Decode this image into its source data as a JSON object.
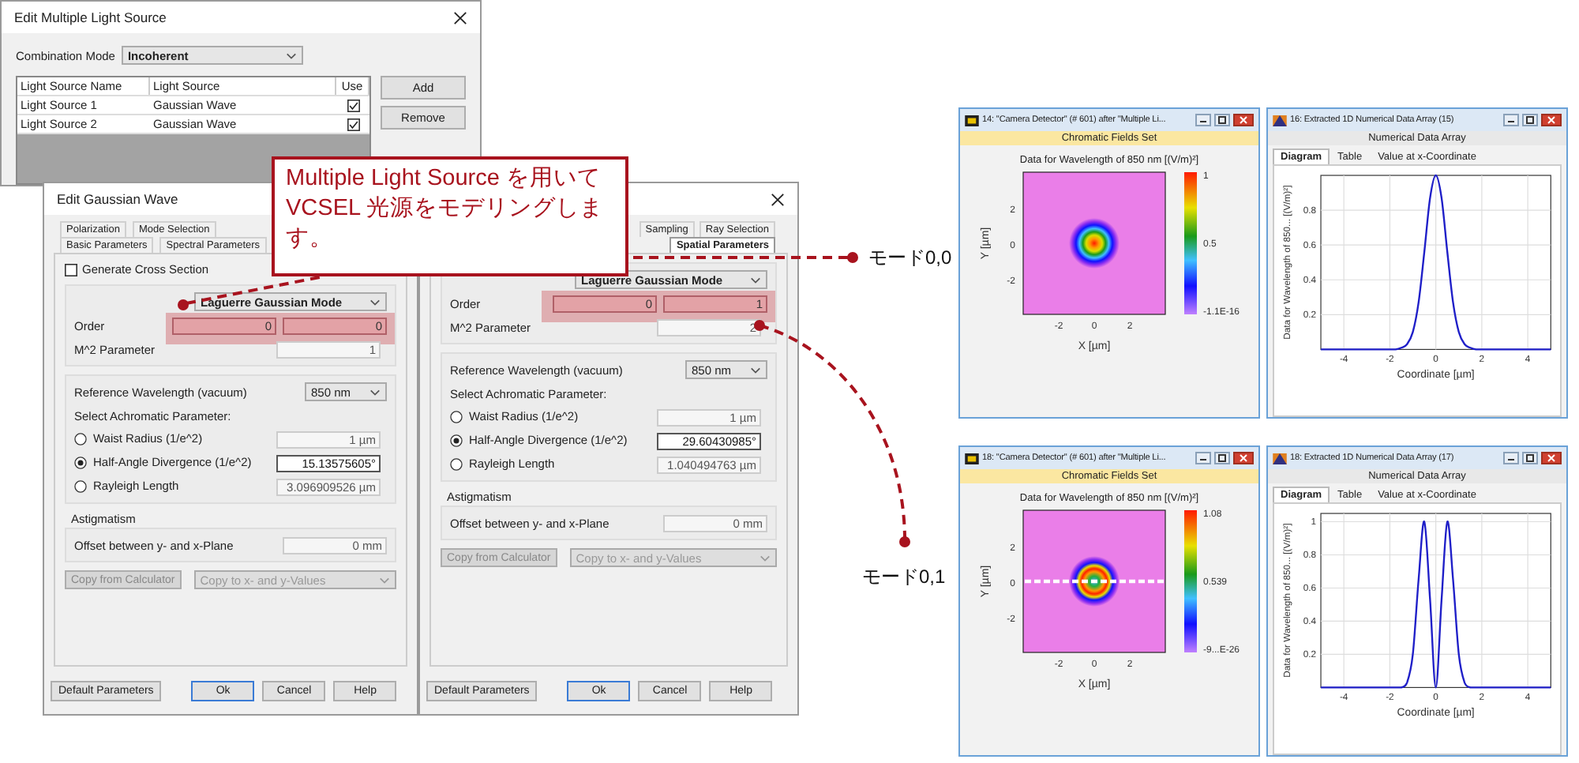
{
  "source_dialog": {
    "title": "Edit Multiple Light Source",
    "combination_label": "Combination Mode",
    "combination_value": "Incoherent",
    "columns": [
      "Light Source Name",
      "Light Source",
      "Use"
    ],
    "rows": [
      {
        "name": "Light Source 1",
        "source": "Gaussian Wave",
        "use": true
      },
      {
        "name": "Light Source 2",
        "source": "Gaussian Wave",
        "use": true
      }
    ],
    "buttons": [
      "Add",
      "Remove"
    ]
  },
  "gaussian_dialogs": [
    {
      "title": "Edit Gaussian Wave",
      "tab_rows": [
        [
          {
            "label": "Polarization",
            "selected": false
          },
          {
            "label": "Mode Selection",
            "selected": false
          }
        ],
        [
          {
            "label": "Basic Parameters",
            "selected": false
          },
          {
            "label": "Spectral Parameters",
            "selected": false
          }
        ]
      ],
      "cross_section": {
        "label": "Generate Cross Section",
        "checked": false
      },
      "mode": "Laguerre Gaussian Mode",
      "order_label": "Order",
      "order": [
        "0",
        "0"
      ],
      "m2_label": "M^2 Parameter",
      "m2": "1",
      "wavelength_label": "Reference Wavelength (vacuum)",
      "wavelength": "850 nm",
      "achromatic_label": "Select Achromatic Parameter:",
      "params": [
        {
          "label": "Waist Radius (1/e^2)",
          "value": "1 µm",
          "selected": false
        },
        {
          "label": "Half-Angle Divergence (1/e^2)",
          "value": "15.13575605°",
          "selected": true
        },
        {
          "label": "Rayleigh Length",
          "value": "3.096909526 µm",
          "selected": false
        }
      ],
      "astigmatism_label": "Astigmatism",
      "offset_label": "Offset between y- and x-Plane",
      "offset": "0 mm",
      "copy_button": "Copy from Calculator",
      "copy_select": "Copy to x- and y-Values",
      "buttons": [
        "Default Parameters",
        "Ok",
        "Cancel",
        "Help"
      ]
    },
    {
      "tab_rows": [
        [
          {
            "label": "Sampling",
            "selected": false
          },
          {
            "label": "Ray Selection",
            "selected": false
          }
        ],
        [
          {
            "label": "Spatial Parameters",
            "selected": true
          }
        ]
      ],
      "mode": "Laguerre Gaussian Mode",
      "order_label": "Order",
      "order": [
        "0",
        "1"
      ],
      "m2_label": "M^2 Parameter",
      "m2": "2",
      "wavelength_label": "Reference Wavelength (vacuum)",
      "wavelength": "850 nm",
      "achromatic_label": "Select Achromatic Parameter:",
      "params": [
        {
          "label": "Waist Radius (1/e^2)",
          "value": "1 µm",
          "selected": false
        },
        {
          "label": "Half-Angle Divergence (1/e^2)",
          "value": "29.60430985°",
          "selected": true
        },
        {
          "label": "Rayleigh Length",
          "value": "1.040494763 µm",
          "selected": false
        }
      ],
      "astigmatism_label": "Astigmatism",
      "offset_label": "Offset between y- and x-Plane",
      "offset": "0 mm",
      "copy_button": "Copy from Calculator",
      "copy_select": "Copy to x- and y-Values",
      "buttons": [
        "Default Parameters",
        "Ok",
        "Cancel",
        "Help"
      ]
    }
  ],
  "callout": "Multiple Light Source を用いて VCSEL 光源をモデリングします。",
  "mode_labels": [
    "モード0,0",
    "モード0,1"
  ],
  "detector_windows": [
    {
      "title": "14: \"Camera Detector\" (# 601) after \"Multiple Li...",
      "subtitle": "Chromatic Fields Set",
      "plot_title": "Data for Wavelength of 850 nm  [(V/m)²]",
      "kind": "spot",
      "cut_line": false,
      "xlabel": "X [µm]",
      "ylabel": "Y [µm]",
      "x_ticks": [
        "-2",
        "0",
        "2"
      ],
      "y_ticks": [
        "2",
        "0",
        "-2"
      ],
      "colorbar_labels": [
        "1",
        "0.5",
        "-1.1E-16"
      ]
    },
    {
      "title": "18: \"Camera Detector\" (# 601) after \"Multiple Li...",
      "subtitle": "Chromatic Fields Set",
      "plot_title": "Data for Wavelength of 850 nm  [(V/m)²]",
      "kind": "ring",
      "cut_line": true,
      "xlabel": "X [µm]",
      "ylabel": "Y [µm]",
      "x_ticks": [
        "-2",
        "0",
        "2"
      ],
      "y_ticks": [
        "2",
        "0",
        "-2"
      ],
      "colorbar_labels": [
        "1.08",
        "0.539",
        "-9...E-26"
      ]
    }
  ],
  "profile_windows": [
    {
      "title": "16: Extracted 1D Numerical Data Array (15)",
      "subtitle": "Numerical Data Array",
      "tabs": [
        {
          "label": "Diagram",
          "selected": true
        },
        {
          "label": "Table",
          "selected": false
        },
        {
          "label": "Value at x-Coordinate",
          "selected": false
        }
      ],
      "chart_data": {
        "type": "line",
        "xlabel": "Coordinate [µm]",
        "ylabel": "Data for Wavelength of 850... [(V/m)²]",
        "x": [
          -5,
          -4,
          -3,
          -2,
          -1.75,
          -1.5,
          -1.25,
          -1,
          -0.75,
          -0.5,
          -0.25,
          0,
          0.25,
          0.5,
          0.75,
          1,
          1.25,
          1.5,
          1.75,
          2,
          3,
          4,
          5
        ],
        "series": [
          {
            "color": "#1f1fc8",
            "values": [
              0,
              0,
              0,
              0,
              0,
              0.01,
              0.03,
              0.1,
              0.27,
              0.56,
              0.87,
              1,
              0.87,
              0.56,
              0.27,
              0.1,
              0.03,
              0.01,
              0,
              0,
              0,
              0,
              0
            ]
          }
        ],
        "xlim": [
          -5,
          5
        ],
        "ylim": [
          0,
          1
        ],
        "xticks": [
          -4,
          -2,
          0,
          2,
          4
        ],
        "yticks": [
          0.2,
          0.4,
          0.6,
          0.8
        ],
        "grid": true
      }
    },
    {
      "title": "18: Extracted 1D Numerical Data Array (17)",
      "subtitle": "Numerical Data Array",
      "tabs": [
        {
          "label": "Diagram",
          "selected": true
        },
        {
          "label": "Table",
          "selected": false
        },
        {
          "label": "Value at x-Coordinate",
          "selected": false
        }
      ],
      "chart_data": {
        "type": "line",
        "xlabel": "Coordinate [µm]",
        "ylabel": "Data for Wavelength of 850... [(V/m)²]",
        "x": [
          -5,
          -4,
          -3,
          -2,
          -1.75,
          -1.5,
          -1.25,
          -1,
          -0.75,
          -0.5,
          -0.25,
          0,
          0.25,
          0.5,
          0.75,
          1,
          1.25,
          1.5,
          1.75,
          2,
          3,
          4,
          5
        ],
        "series": [
          {
            "color": "#1f1fc8",
            "values": [
              0,
              0,
              0,
              0,
              0,
              0,
              0.03,
              0.2,
              0.65,
              1,
              0.53,
              0,
              0.53,
              1,
              0.65,
              0.2,
              0.03,
              0,
              0,
              0,
              0,
              0,
              0
            ]
          }
        ],
        "xlim": [
          -5,
          5
        ],
        "ylim": [
          0,
          1.05
        ],
        "xticks": [
          -4,
          -2,
          0,
          2,
          4
        ],
        "yticks": [
          0.2,
          0.4,
          0.6,
          0.8,
          1
        ],
        "grid": true
      }
    }
  ]
}
